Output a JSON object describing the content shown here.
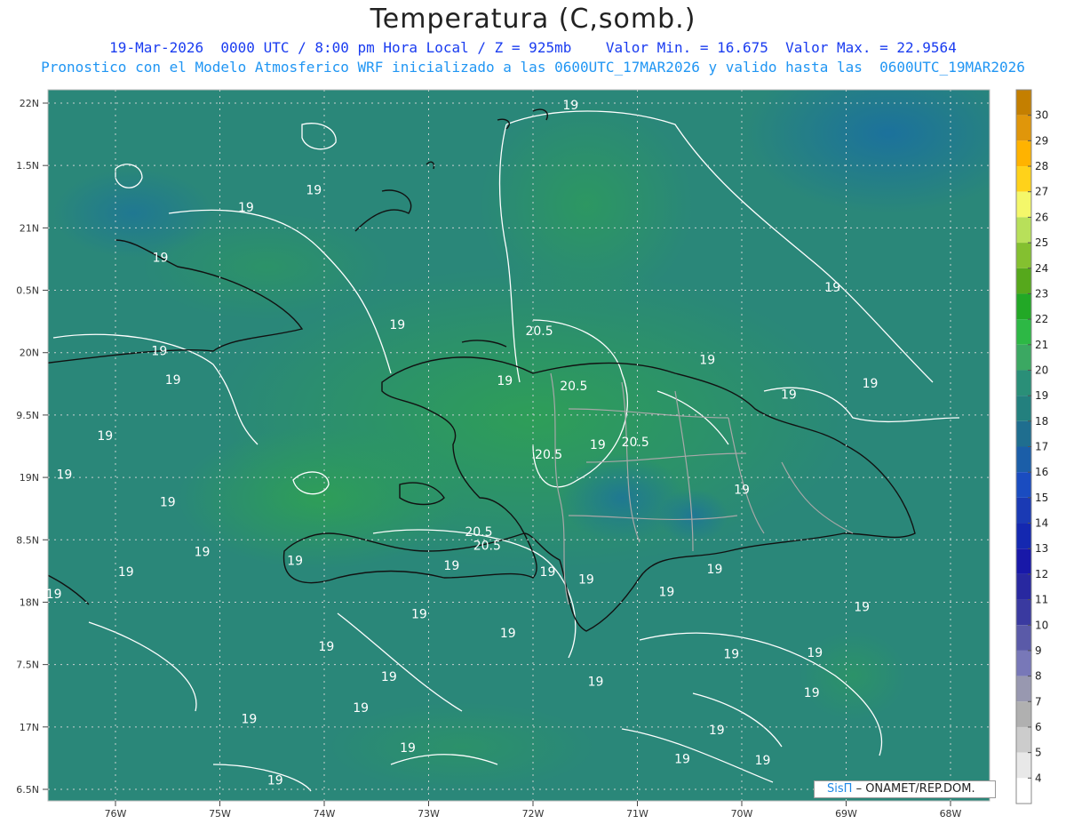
{
  "header": {
    "title": "Temperatura (C,somb.)",
    "line1": "19-Mar-2026  0000 UTC / 8:00 pm Hora Local / Z = 925mb    Valor Min. = 16.675  Valor Max. = 22.9564",
    "line2": "Pronostico con el Modelo Atmosferico WRF inicializado a las 0600UTC_17MAR2026 y valido hasta las  0600UTC_19MAR2026"
  },
  "axes": {
    "lat_labels": [
      "22N",
      "1.5N",
      "21N",
      "0.5N",
      "20N",
      "9.5N",
      "19N",
      "8.5N",
      "18N",
      "7.5N",
      "17N",
      "6.5N"
    ],
    "lon_labels": [
      "76W",
      "75W",
      "74W",
      "73W",
      "72W",
      "71W",
      "70W",
      "69W",
      "68W"
    ]
  },
  "colorbar": {
    "labels": [
      "30",
      "29",
      "28",
      "27",
      "26",
      "25",
      "24",
      "23",
      "22",
      "21",
      "20",
      "19",
      "18",
      "17",
      "16",
      "15",
      "14",
      "13",
      "12",
      "11",
      "10",
      "9",
      "8",
      "7",
      "6",
      "5",
      "4"
    ],
    "colors": [
      "#c47f00",
      "#e0960a",
      "#ffb300",
      "#ffd21a",
      "#f4f76a",
      "#b8e05a",
      "#84c030",
      "#56a81c",
      "#22a826",
      "#2db845",
      "#3ba862",
      "#2a8f78",
      "#23807e",
      "#1f6e8f",
      "#1b5ea8",
      "#1a4cc0",
      "#1a3ab4",
      "#1428b0",
      "#1818a8",
      "#2828a0",
      "#3a3aa0",
      "#5a5aa8",
      "#7878b8",
      "#9898b0",
      "#b0b0b0",
      "#cccccc",
      "#e8e8e8",
      "#ffffff"
    ]
  },
  "contours": {
    "labels": [
      {
        "text": "19",
        "lon": -71.64,
        "lat": 21.95
      },
      {
        "text": "19",
        "lon": -74.1,
        "lat": 21.27
      },
      {
        "text": "19",
        "lon": -74.75,
        "lat": 21.13
      },
      {
        "text": "19",
        "lon": -75.57,
        "lat": 20.73
      },
      {
        "text": "19",
        "lon": -69.13,
        "lat": 20.49
      },
      {
        "text": "20.5",
        "lon": -71.94,
        "lat": 20.14
      },
      {
        "text": "19",
        "lon": -73.3,
        "lat": 20.19
      },
      {
        "text": "19",
        "lon": -75.58,
        "lat": 19.98
      },
      {
        "text": "19",
        "lon": -70.33,
        "lat": 19.91
      },
      {
        "text": "19",
        "lon": -75.45,
        "lat": 19.75
      },
      {
        "text": "20.5",
        "lon": -71.61,
        "lat": 19.7
      },
      {
        "text": "19",
        "lon": -72.27,
        "lat": 19.74
      },
      {
        "text": "19",
        "lon": -69.55,
        "lat": 19.63
      },
      {
        "text": "19",
        "lon": -68.77,
        "lat": 19.72
      },
      {
        "text": "19",
        "lon": -76.1,
        "lat": 19.3
      },
      {
        "text": "20.5",
        "lon": -71.02,
        "lat": 19.25
      },
      {
        "text": "19",
        "lon": -71.38,
        "lat": 19.23
      },
      {
        "text": "20.5",
        "lon": -71.85,
        "lat": 19.15
      },
      {
        "text": "19",
        "lon": -76.49,
        "lat": 18.99
      },
      {
        "text": "19",
        "lon": -70.0,
        "lat": 18.87
      },
      {
        "text": "19",
        "lon": -75.5,
        "lat": 18.77
      },
      {
        "text": "20.5",
        "lon": -72.52,
        "lat": 18.53
      },
      {
        "text": "20.5",
        "lon": -72.44,
        "lat": 18.42
      },
      {
        "text": "19",
        "lon": -74.28,
        "lat": 18.3
      },
      {
        "text": "19",
        "lon": -75.17,
        "lat": 18.37
      },
      {
        "text": "19",
        "lon": -75.9,
        "lat": 18.21
      },
      {
        "text": "19",
        "lon": -72.78,
        "lat": 18.26
      },
      {
        "text": "19",
        "lon": -71.49,
        "lat": 18.15
      },
      {
        "text": "19",
        "lon": -71.86,
        "lat": 18.21
      },
      {
        "text": "19",
        "lon": -70.26,
        "lat": 18.23
      },
      {
        "text": "19",
        "lon": -76.59,
        "lat": 18.03
      },
      {
        "text": "19",
        "lon": -70.72,
        "lat": 18.05
      },
      {
        "text": "19",
        "lon": -68.85,
        "lat": 17.93
      },
      {
        "text": "19",
        "lon": -73.09,
        "lat": 17.87
      },
      {
        "text": "19",
        "lon": -72.24,
        "lat": 17.72
      },
      {
        "text": "19",
        "lon": -73.98,
        "lat": 17.61
      },
      {
        "text": "19",
        "lon": -70.1,
        "lat": 17.55
      },
      {
        "text": "19",
        "lon": -69.3,
        "lat": 17.56
      },
      {
        "text": "19",
        "lon": -73.38,
        "lat": 17.37
      },
      {
        "text": "19",
        "lon": -71.4,
        "lat": 17.33
      },
      {
        "text": "19",
        "lon": -69.33,
        "lat": 17.24
      },
      {
        "text": "19",
        "lon": -73.65,
        "lat": 17.12
      },
      {
        "text": "19",
        "lon": -74.72,
        "lat": 17.03
      },
      {
        "text": "19",
        "lon": -70.24,
        "lat": 16.94
      },
      {
        "text": "19",
        "lon": -73.2,
        "lat": 16.8
      },
      {
        "text": "19",
        "lon": -70.57,
        "lat": 16.71
      },
      {
        "text": "19",
        "lon": -69.8,
        "lat": 16.7
      },
      {
        "text": "19",
        "lon": -74.47,
        "lat": 16.54
      }
    ]
  },
  "credit": {
    "brand": "SisΠ",
    "text": "– ONAMET/REP.DOM."
  }
}
